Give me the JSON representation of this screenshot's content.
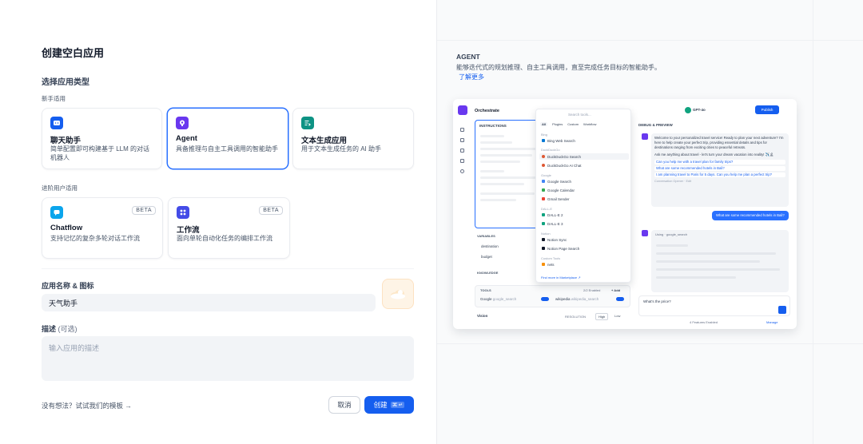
{
  "left": {
    "title": "创建空白应用",
    "section_type": "选择应用类型",
    "group_beginner": "新手适用",
    "group_advanced": "进阶用户适用",
    "cards": [
      {
        "title": "聊天助手",
        "desc": "简单配置即可构建基于 LLM 的对话机器人",
        "icon": "chat-bot-icon",
        "color": "#155eef"
      },
      {
        "title": "Agent",
        "desc": "具备推理与自主工具调用的智能助手",
        "icon": "agent-icon",
        "color": "#6938ef"
      },
      {
        "title": "文本生成应用",
        "desc": "用于文本生成任务的 AI 助手",
        "icon": "text-generation-icon",
        "color": "#0e9384"
      },
      {
        "title": "Chatflow",
        "desc": "支持记忆的复杂多轮对话工作流",
        "icon": "chatflow-icon",
        "color": "#0ba5ec",
        "badge": "BETA"
      },
      {
        "title": "工作流",
        "desc": "面向单轮自动化任务的编排工作流",
        "icon": "workflow-icon",
        "color": "#444ce7",
        "badge": "BETA"
      }
    ],
    "name_label": "应用名称 & 图标",
    "name_value": "天气助手",
    "desc_label": "描述",
    "desc_optional": "(可选)",
    "desc_placeholder": "输入应用的描述",
    "template_link": "没有想法？试试我们的模板 →",
    "cancel": "取消",
    "create": "创建",
    "create_shortcut": "⌘ ↵"
  },
  "right": {
    "title": "AGENT",
    "desc": "能够迭代式的规划推理、自主工具调用，直至完成任务目标的智能助手。",
    "link": "了解更多",
    "mock": {
      "header": "Orchestrate",
      "model": "GPT-4o",
      "publish": "Publish",
      "instructions": "INSTRUCTIONS",
      "debug": "DEBUG & PREVIEW",
      "variables": "VARIABLES",
      "knowledge": "KNOWLEDGE",
      "tools": "TOOLS",
      "tools_enabled": "2/2 Enabled",
      "add": "+ Add",
      "vision": "Vision",
      "resolution": "RESOLUTION",
      "high": "High",
      "low": "Low",
      "var_names": [
        "destination",
        "budget"
      ],
      "tool_google": "Google",
      "tool_google_sub": "google_search",
      "tool_wiki": "wikipedia",
      "tool_wiki_sub": "wikipedia_search",
      "dd_search": "Search tools...",
      "dd_tabs": [
        "All",
        "Plugins",
        "Custom",
        "Workflow"
      ],
      "dd_groups": [
        "Bing",
        "DuckDuckGo",
        "Google",
        "DALL-E",
        "Notion",
        "Custom Tools"
      ],
      "dd_items": [
        "Bing Web Search",
        "DuckDuckGo Search",
        "DuckDuckGo AI Chat",
        "Google Search",
        "Google Calendar",
        "Gmail Sender",
        "DALL-E 2",
        "DALL-E 3",
        "Notion Sync",
        "Notion Page Search",
        "nets"
      ],
      "dd_footer": "Find more in Marketplace ↗",
      "chat_welcome": "Welcome to your personalized travel service! Ready to plan your next adventure? I'm here to help create your perfect trip, providing essential details and tips for destinations ranging from exciting cities to peaceful retreats.",
      "chat_ask": "Ask me anything about travel - let's turn your dream vacation into reality! ✈️🏝",
      "suggestions": [
        "Can you help me with a travel plan for family trips?",
        "What are some recommended hotels in Bali?",
        "I am planning travel to Paris for 5 days. Can you help me plan a perfect trip?"
      ],
      "opener": "Conversation Opener · Edit",
      "user_msg": "What are some recommended hotels in Bali?",
      "using": "Using",
      "using_tool": "google_search",
      "chat_input": "What's the price?",
      "features": "4 Features Enabled",
      "manage": "Manage"
    }
  }
}
